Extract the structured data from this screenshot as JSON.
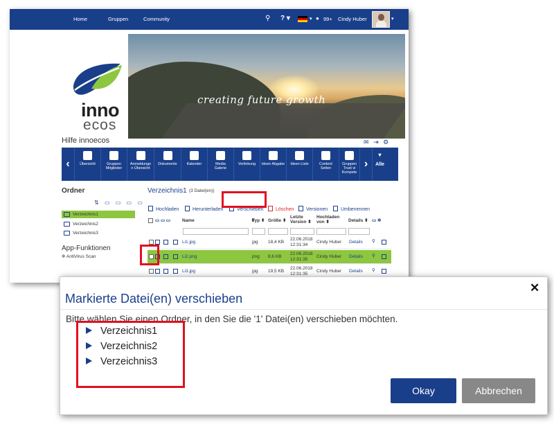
{
  "topnav": {
    "items": [
      "Home",
      "Gruppen",
      "Community"
    ],
    "notifications": "99+",
    "user": "Cindy Huber"
  },
  "logo": {
    "line1": "inno",
    "line2": "ecos"
  },
  "banner": {
    "slogan": "creating future growth"
  },
  "page_title": "Hilfe innoecos",
  "toolbar": {
    "items": [
      [
        "Übersicht"
      ],
      [
        "Gruppen",
        "Mitglieder"
      ],
      [
        "Anmeldunge",
        "n Übersicht"
      ],
      [
        "Dokumente"
      ],
      [
        "Kalender"
      ],
      [
        "Media",
        "Galerie"
      ],
      [
        "Verlinkung"
      ],
      [
        "Ideen Abgabe"
      ],
      [
        "Ideen Liste"
      ],
      [
        "Content",
        "Seiten"
      ],
      [
        "Gruppen",
        "Trust vi",
        "Kompete"
      ]
    ],
    "more_label": "Alle"
  },
  "sidebar": {
    "heading": "Ordner",
    "folders": [
      "Verzeichnis1",
      "Verzeichnis2",
      "Verzeichnis3"
    ],
    "selected": "Verzeichnis1",
    "apps_heading": "App-Funktionen",
    "apps": [
      "AntiVirus Scan"
    ]
  },
  "main": {
    "directory": "Verzeichnis1",
    "file_count": "(3 Datei(en))",
    "actions": [
      "Hochladen",
      "Herunterladen",
      "Verschieben",
      "Löschen",
      "Versionen",
      "Umbenennen"
    ],
    "columns": {
      "name": "Name",
      "type": "Typ",
      "size": "Größe",
      "version": [
        "Letzte",
        "Version"
      ],
      "uploaded_by": [
        "Hochladen",
        "von"
      ],
      "details": "Details"
    },
    "rows": [
      {
        "name": "Li1.jpg",
        "type": "jpg",
        "size": "18,4 KB",
        "date": "22.06.2018",
        "time": "12:31:34",
        "user": "Cindy Huber",
        "details": "Details",
        "selected": false
      },
      {
        "name": "Li2.png",
        "type": "png",
        "size": "8,6 KB",
        "date": "22.06.2018",
        "time": "12:31:35",
        "user": "Cindy Huber",
        "details": "Details",
        "selected": true
      },
      {
        "name": "Li3.jpg",
        "type": "jpg",
        "size": "19,5 KB",
        "date": "22.06.2018",
        "time": "12:31:35",
        "user": "Cindy Huber",
        "details": "Details",
        "selected": false
      }
    ]
  },
  "dialog": {
    "title": "Markierte Datei(en) verschieben",
    "message": "Bitte wählen Sie einen Ordner, in den Sie die '1' Datei(en) verschieben möchten.",
    "options": [
      "Verzeichnis1",
      "Verzeichnis2",
      "Verzeichnis3"
    ],
    "ok_label": "Okay",
    "cancel_label": "Abbrechen",
    "close_glyph": "✕"
  },
  "colors": {
    "brand": "#1a3f8a",
    "selection": "#8dc63f",
    "highlight": "#e01020",
    "delete": "#d9262c"
  }
}
